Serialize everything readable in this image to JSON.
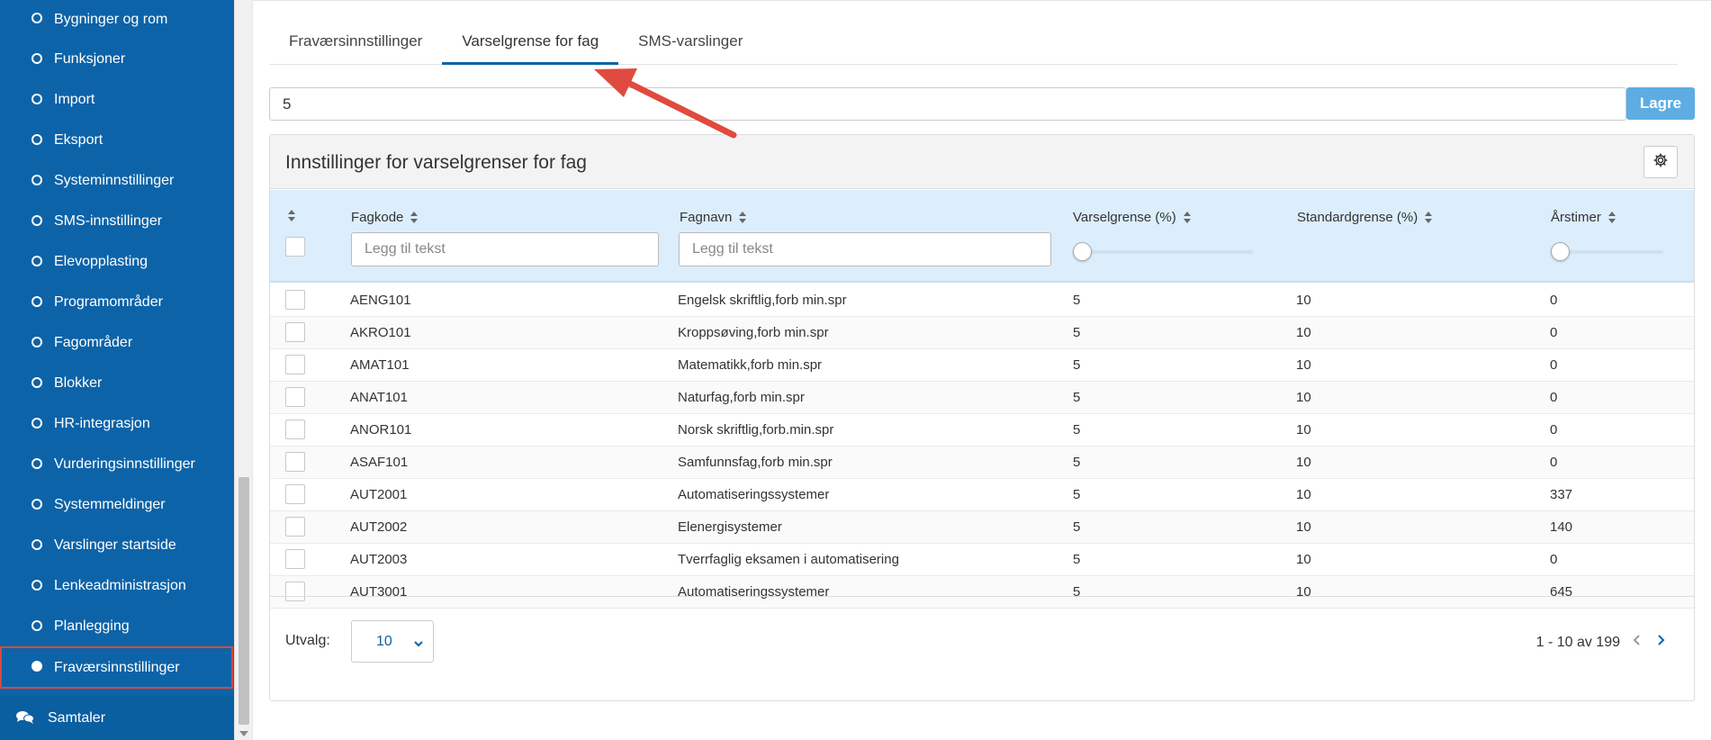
{
  "sidebar": {
    "items": [
      {
        "label": "Bygninger og rom"
      },
      {
        "label": "Funksjoner"
      },
      {
        "label": "Import"
      },
      {
        "label": "Eksport"
      },
      {
        "label": "Systeminnstillinger"
      },
      {
        "label": "SMS-innstillinger"
      },
      {
        "label": "Elevopplasting"
      },
      {
        "label": "Programområder"
      },
      {
        "label": "Fagområder"
      },
      {
        "label": "Blokker"
      },
      {
        "label": "HR-integrasjon"
      },
      {
        "label": "Vurderingsinnstillinger"
      },
      {
        "label": "Systemmeldinger"
      },
      {
        "label": "Varslinger startside"
      },
      {
        "label": "Lenkeadministrasjon"
      },
      {
        "label": "Planlegging"
      },
      {
        "label": "Fraværsinnstillinger"
      }
    ],
    "active_index": 16,
    "bottom_label": "Samtaler"
  },
  "tabs": [
    {
      "label": "Fraværsinnstillinger"
    },
    {
      "label": "Varselgrense for fag"
    },
    {
      "label": "SMS-varslinger"
    }
  ],
  "active_tab": 1,
  "threshold_input": {
    "value": "5"
  },
  "save_label": "Lagre",
  "panel": {
    "title": "Innstillinger for varselgrenser for fag",
    "columns": {
      "fagkode": "Fagkode",
      "fagnavn": "Fagnavn",
      "varselgrense": "Varselgrense (%)",
      "standardgrense": "Standardgrense (%)",
      "arstimer": "Årstimer"
    },
    "filters": {
      "fagkode_placeholder": "Legg til tekst",
      "fagnavn_placeholder": "Legg til tekst"
    },
    "rows": [
      {
        "code": "AENG101",
        "name": "Engelsk skriftlig,forb min.spr",
        "varsel": "5",
        "standard": "10",
        "timer": "0"
      },
      {
        "code": "AKRO101",
        "name": "Kroppsøving,forb min.spr",
        "varsel": "5",
        "standard": "10",
        "timer": "0"
      },
      {
        "code": "AMAT101",
        "name": "Matematikk,forb min.spr",
        "varsel": "5",
        "standard": "10",
        "timer": "0"
      },
      {
        "code": "ANAT101",
        "name": "Naturfag,forb min.spr",
        "varsel": "5",
        "standard": "10",
        "timer": "0"
      },
      {
        "code": "ANOR101",
        "name": "Norsk skriftlig,forb.min.spr",
        "varsel": "5",
        "standard": "10",
        "timer": "0"
      },
      {
        "code": "ASAF101",
        "name": "Samfunnsfag,forb min.spr",
        "varsel": "5",
        "standard": "10",
        "timer": "0"
      },
      {
        "code": "AUT2001",
        "name": "Automatiseringssystemer",
        "varsel": "5",
        "standard": "10",
        "timer": "337"
      },
      {
        "code": "AUT2002",
        "name": "Elenergisystemer",
        "varsel": "5",
        "standard": "10",
        "timer": "140"
      },
      {
        "code": "AUT2003",
        "name": "Tverrfaglig eksamen i automatisering",
        "varsel": "5",
        "standard": "10",
        "timer": "0"
      },
      {
        "code": "AUT3001",
        "name": "Automatiseringssystemer",
        "varsel": "5",
        "standard": "10",
        "timer": "645"
      }
    ],
    "footer": {
      "utvalg_label": "Utvalg:",
      "utvalg_value": "10",
      "pager_text": "1 - 10 av 199"
    }
  },
  "colors": {
    "sidebar_bg": "#0d63a8",
    "accent": "#0d63a8",
    "save_button": "#5dade2",
    "table_header": "#dcedfc",
    "highlight_border": "#d9473f",
    "annotation_arrow": "#e04a3f"
  }
}
